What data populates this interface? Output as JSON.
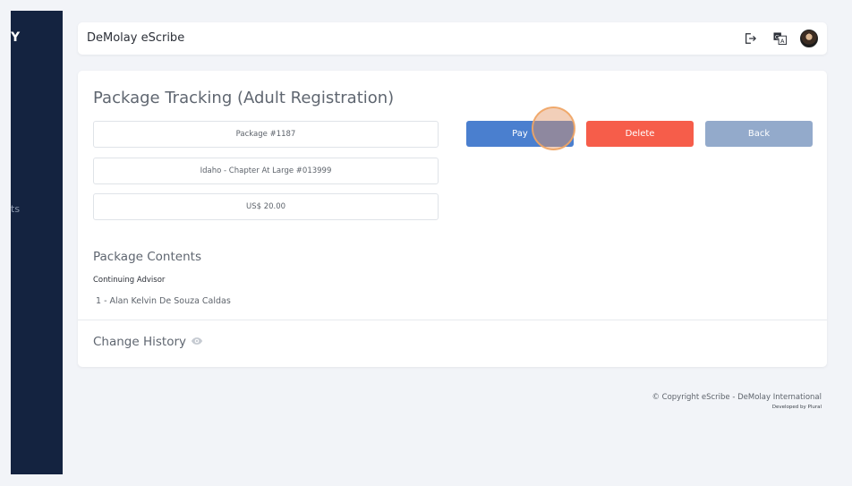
{
  "sidebar": {
    "logo_fragment": "Y",
    "nav_fragment": "ts"
  },
  "header": {
    "app_title": "DeMolay eScribe",
    "icons": [
      "logout-icon",
      "translate-icon",
      "avatar"
    ]
  },
  "page": {
    "title": "Package Tracking (Adult Registration)",
    "info": {
      "package": "Package #1187",
      "chapter": "Idaho - Chapter At Large #013999",
      "amount": "US$ 20.00"
    },
    "buttons": {
      "pay": "Pay",
      "delete": "Delete",
      "back": "Back"
    },
    "contents": {
      "title": "Package Contents",
      "group_label": "Continuing Advisor",
      "items": [
        "1 - Alan Kelvin De Souza Caldas"
      ]
    },
    "history_title": "Change History"
  },
  "footer": {
    "copyright": "© Copyright eScribe - DeMolay International",
    "credits": "Developed by Plural"
  },
  "colors": {
    "sidebar": "#142340",
    "pay": "#4a7fcf",
    "delete": "#f65d4a",
    "back": "#93aacb",
    "background": "#f2f4f8"
  }
}
